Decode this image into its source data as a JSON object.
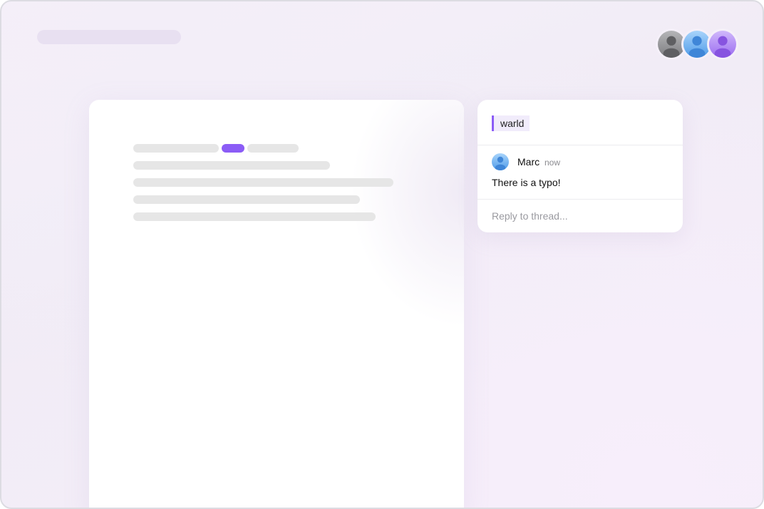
{
  "thread": {
    "quoted_text": "warld",
    "comment": {
      "author": "Marc",
      "time": "now",
      "text": "There is a typo!"
    },
    "reply_placeholder": "Reply to thread..."
  },
  "collaborators": [
    {
      "icon": "user-avatar-gray-icon",
      "color": "#8e8e93"
    },
    {
      "icon": "user-avatar-blue-icon",
      "color": "#5aa7f0"
    },
    {
      "icon": "user-avatar-purple-icon",
      "color": "#a37af2"
    }
  ],
  "colors": {
    "accent": "#8b5cf6",
    "placeholder_line": "#e6e6e6"
  }
}
